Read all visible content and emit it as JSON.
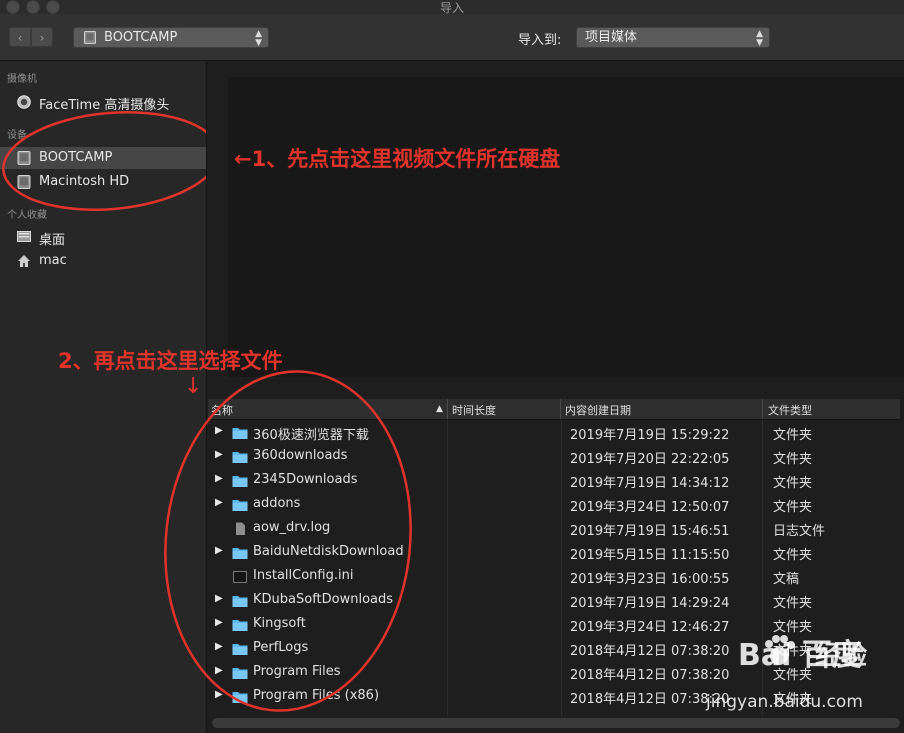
{
  "window": {
    "title": "导入"
  },
  "toolbar": {
    "back": "‹",
    "forward": "›",
    "source": "BOOTCAMP",
    "import_to_label": "导入到:",
    "import_to_value": "项目媒体"
  },
  "sidebar": {
    "sections": [
      {
        "label": "摄像机",
        "items": [
          {
            "label": "FaceTime 高清摄像头",
            "icon": "camera-icon"
          }
        ]
      },
      {
        "label": "设备",
        "items": [
          {
            "label": "BOOTCAMP",
            "icon": "drive-icon",
            "selected": true
          },
          {
            "label": "Macintosh HD",
            "icon": "drive-icon"
          }
        ]
      },
      {
        "label": "个人收藏",
        "items": [
          {
            "label": "桌面",
            "icon": "desktop-icon"
          },
          {
            "label": "mac",
            "icon": "home-icon"
          }
        ]
      }
    ]
  },
  "table": {
    "headers": {
      "name": "名称",
      "duration": "时间长度",
      "created": "内容创建日期",
      "type": "文件类型"
    },
    "rows": [
      {
        "name": "360极速浏览器下载",
        "date": "2019年7月19日 15:29:22",
        "type": "文件夹",
        "kind": "folder"
      },
      {
        "name": "360downloads",
        "date": "2019年7月20日 22:22:05",
        "type": "文件夹",
        "kind": "folder"
      },
      {
        "name": "2345Downloads",
        "date": "2019年7月19日 14:34:12",
        "type": "文件夹",
        "kind": "folder"
      },
      {
        "name": "addons",
        "date": "2019年3月24日 12:50:07",
        "type": "文件夹",
        "kind": "folder"
      },
      {
        "name": "aow_drv.log",
        "date": "2019年7月19日 15:46:51",
        "type": "日志文件",
        "kind": "log"
      },
      {
        "name": "BaiduNetdiskDownload",
        "date": "2019年5月15日 11:15:50",
        "type": "文件夹",
        "kind": "folder"
      },
      {
        "name": "InstallConfig.ini",
        "date": "2019年3月23日 16:00:55",
        "type": "文稿",
        "kind": "doc"
      },
      {
        "name": "KDubaSoftDownloads",
        "date": "2019年7月19日 14:29:24",
        "type": "文件夹",
        "kind": "folder"
      },
      {
        "name": "Kingsoft",
        "date": "2019年3月24日 12:46:27",
        "type": "文件夹",
        "kind": "folder"
      },
      {
        "name": "PerfLogs",
        "date": "2018年4月12日 07:38:20",
        "type": "文件夹",
        "kind": "folder"
      },
      {
        "name": "Program Files",
        "date": "2018年4月12日 07:38:20",
        "type": "文件夹",
        "kind": "folder"
      },
      {
        "name": "Program Files (x86)",
        "date": "2018年4月12日 07:38:20",
        "type": "文件夹",
        "kind": "folder"
      }
    ]
  },
  "annotations": {
    "step1": "←1、先点击这里视频文件所在硬盘",
    "step2": "2、再点击这里选择文件",
    "arrow": "↓"
  },
  "watermark": {
    "logo": "Bai 百度",
    "brand": "经验",
    "url": "jingyan.baidu.com"
  },
  "colors": {
    "annotation": "#e0332b",
    "folder": "#5cb8f0",
    "selection": "#464646"
  }
}
